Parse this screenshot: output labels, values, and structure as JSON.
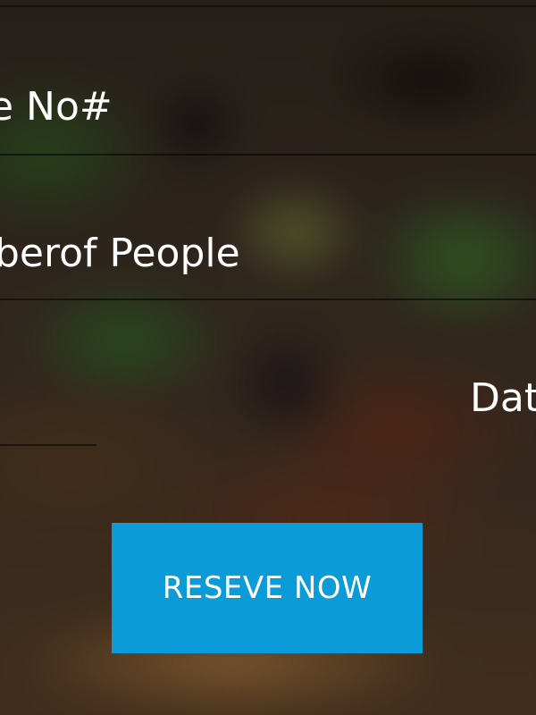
{
  "form": {
    "phone_field_label": "e No#",
    "people_field_label": "berof People",
    "date_field_label": "Dat"
  },
  "actions": {
    "reserve_label": "RESEVE NOW"
  },
  "colors": {
    "button_background": "#0a9bd8",
    "field_text": "#ffffff"
  }
}
